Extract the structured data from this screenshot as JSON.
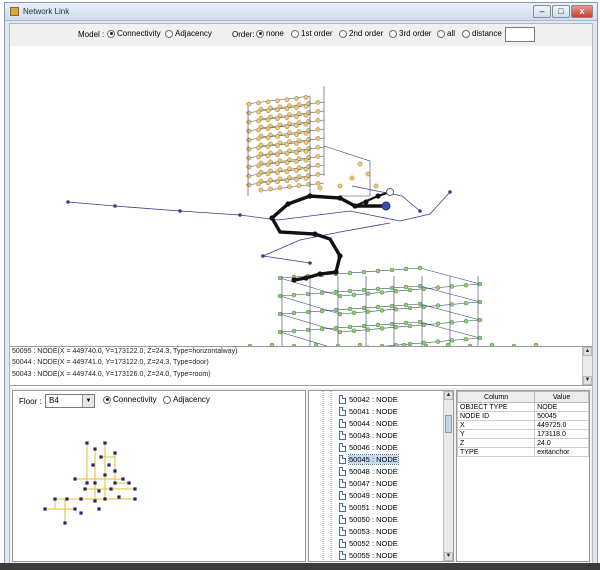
{
  "window": {
    "title": "Network Link"
  },
  "toolbar": {
    "model_label": "Model :",
    "model_options": [
      "Connectivity",
      "Adjacency"
    ],
    "order_label": "Order:",
    "order_options": [
      "none",
      "1st order",
      "2nd order",
      "3rd order",
      "all",
      "distance"
    ],
    "distance_value": ""
  },
  "log": {
    "lines": [
      "50095 : NODE(X = 449740.0, Y=173122.0, Z=24.3, Type=horizontalway)",
      "50044 : NODE(X = 449741.0, Y=173122.0, Z=24.3, Type=door)",
      "50043 : NODE(X = 449744.0, Y=173126.0, Z=24.0, Type=room)"
    ]
  },
  "floor": {
    "label": "Floor :",
    "selected": "B4",
    "options": [
      "Connectivity",
      "Adjacency"
    ]
  },
  "tree": {
    "items": [
      "50042 : NODE",
      "50041 : NODE",
      "50044 : NODE",
      "50043 : NODE",
      "50046 : NODE",
      "50045 : NODE",
      "50048 : NODE",
      "50047 : NODE",
      "50049 : NODE",
      "50051 : NODE",
      "50050 : NODE",
      "50053 : NODE",
      "50052 : NODE",
      "50055 : NODE"
    ],
    "selected_index": 5
  },
  "properties": {
    "headers": [
      "Column",
      "Value"
    ],
    "rows": [
      [
        "OBJECT TYPE",
        "NODE"
      ],
      [
        "NODE ID",
        "50045"
      ],
      [
        "X",
        "449725.0"
      ],
      [
        "Y",
        "173118.0"
      ],
      [
        "Z",
        "24.0"
      ],
      [
        "TYPE",
        "exitanchor"
      ]
    ]
  },
  "colors": {
    "upper_nodes": "#e8c97a",
    "lower_nodes": "#8fcf7a",
    "path": "#111111",
    "links": "#3a3a8c",
    "floor_nodes": "#22227a",
    "floor_links": "#e2c12a"
  }
}
